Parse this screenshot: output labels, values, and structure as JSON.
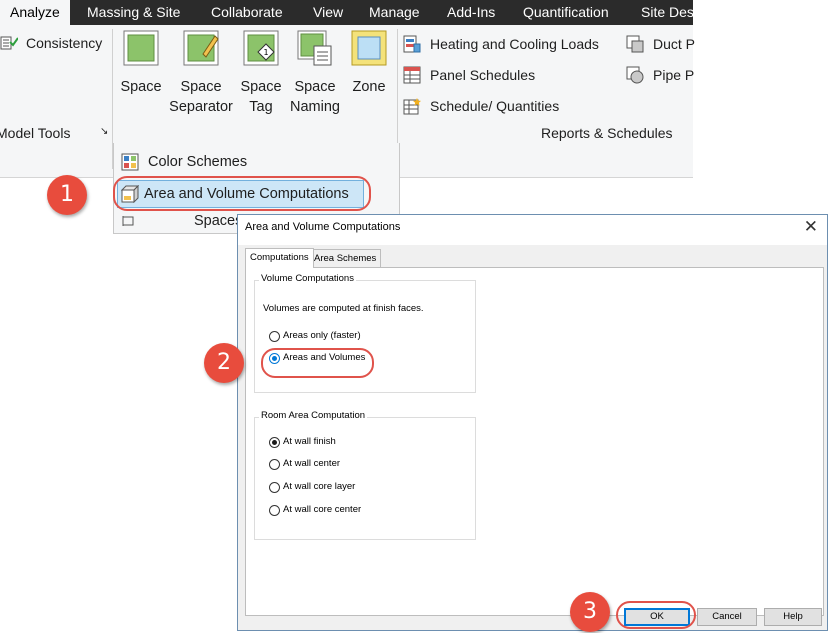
{
  "ribbon": {
    "tabs": [
      "Analyze",
      "Massing & Site",
      "Collaborate",
      "View",
      "Manage",
      "Add-Ins",
      "Quantification",
      "Site Des"
    ],
    "consistency_label": "Consistency",
    "model_tools_label": "Model Tools",
    "panel_launcher": "↘",
    "spaces": [
      {
        "label": "Space",
        "icon": "space-icon"
      },
      {
        "label": "Space\nSeparator",
        "icon": "space-separator-icon"
      },
      {
        "label": "Space\nTag",
        "icon": "space-tag-icon"
      },
      {
        "label": "Space\nNaming",
        "icon": "space-naming-icon"
      },
      {
        "label": "Zone",
        "icon": "zone-icon"
      }
    ],
    "reports": {
      "heating_cooling": "Heating and  Cooling Loads",
      "panel_schedules": "Panel  Schedules",
      "schedule_quantities": "Schedule/  Quantities",
      "duct": "Duct P",
      "pipe": "Pipe P",
      "panel_title": "Reports & Schedules"
    }
  },
  "dropdown": {
    "color_schemes": "Color Schemes",
    "area_volume": "Area and Volume Computations",
    "spaces_partial": "Spaces"
  },
  "dialog": {
    "title": "Area and Volume Computations",
    "close": "✕",
    "tabs": [
      "Computations",
      "Area Schemes"
    ],
    "volume_group": {
      "title": "Volume Computations",
      "note": "Volumes are computed at finish faces.",
      "options": [
        "Areas only (faster)",
        "Areas and Volumes"
      ],
      "selected": "Areas and Volumes"
    },
    "room_group": {
      "title": "Room Area Computation",
      "options": [
        "At wall finish",
        "At wall center",
        "At wall core layer",
        "At wall core center"
      ],
      "selected": "At wall finish"
    },
    "buttons": {
      "ok": "OK",
      "cancel": "Cancel",
      "help": "Help"
    }
  },
  "annotations": {
    "step1": "1",
    "step2": "2",
    "step3": "3",
    "color": "#e84c3d"
  }
}
